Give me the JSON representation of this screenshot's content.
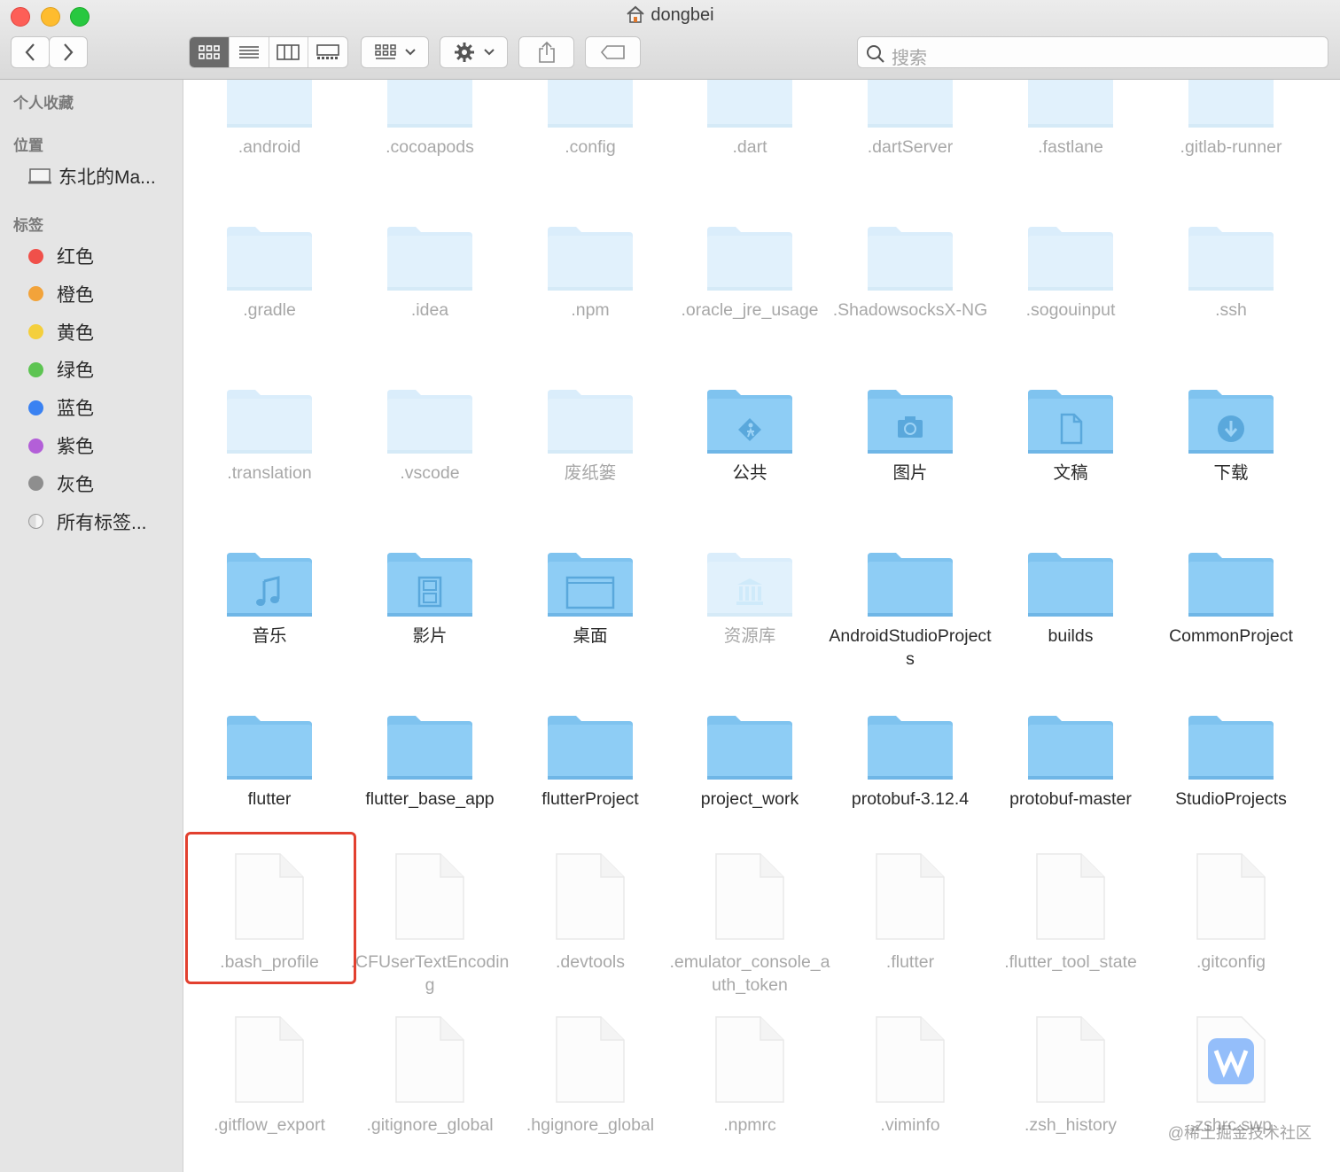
{
  "window": {
    "title": "dongbei"
  },
  "toolbar": {
    "search_placeholder": "搜索",
    "view_modes": [
      "icon-view",
      "list-view",
      "column-view",
      "gallery-view"
    ]
  },
  "sidebar": {
    "favorites_header": "个人收藏",
    "locations_header": "位置",
    "locations": [
      {
        "label": "东北的Ma..."
      }
    ],
    "tags_header": "标签",
    "tags": [
      {
        "label": "红色",
        "color": "#f0504a"
      },
      {
        "label": "橙色",
        "color": "#f2a33a"
      },
      {
        "label": "黄色",
        "color": "#f4cf3c"
      },
      {
        "label": "绿色",
        "color": "#5dc452"
      },
      {
        "label": "蓝色",
        "color": "#3a82f2"
      },
      {
        "label": "紫色",
        "color": "#b35fd8"
      },
      {
        "label": "灰色",
        "color": "#8e8e8e"
      },
      {
        "label": "所有标签...",
        "color": ""
      }
    ]
  },
  "files": [
    [
      {
        "name": ".android",
        "kind": "folder",
        "hidden": true
      },
      {
        "name": ".cocoapods",
        "kind": "folder",
        "hidden": true
      },
      {
        "name": ".config",
        "kind": "folder",
        "hidden": true
      },
      {
        "name": ".dart",
        "kind": "folder",
        "hidden": true
      },
      {
        "name": ".dartServer",
        "kind": "folder",
        "hidden": true
      },
      {
        "name": ".fastlane",
        "kind": "folder",
        "hidden": true
      },
      {
        "name": ".gitlab-runner",
        "kind": "folder",
        "hidden": true
      }
    ],
    [
      {
        "name": ".gradle",
        "kind": "folder",
        "hidden": true
      },
      {
        "name": ".idea",
        "kind": "folder",
        "hidden": true
      },
      {
        "name": ".npm",
        "kind": "folder",
        "hidden": true
      },
      {
        "name": ".oracle_jre_usage",
        "kind": "folder",
        "hidden": true
      },
      {
        "name": ".ShadowsocksX-NG",
        "kind": "folder",
        "hidden": true
      },
      {
        "name": ".sogouinput",
        "kind": "folder",
        "hidden": true
      },
      {
        "name": ".ssh",
        "kind": "folder",
        "hidden": true
      }
    ],
    [
      {
        "name": ".translation",
        "kind": "folder",
        "hidden": true
      },
      {
        "name": ".vscode",
        "kind": "folder",
        "hidden": true
      },
      {
        "name": "废纸篓",
        "kind": "folder",
        "hidden": true
      },
      {
        "name": "公共",
        "kind": "public",
        "hidden": false
      },
      {
        "name": "图片",
        "kind": "pictures",
        "hidden": false
      },
      {
        "name": "文稿",
        "kind": "documents",
        "hidden": false
      },
      {
        "name": "下载",
        "kind": "downloads",
        "hidden": false
      }
    ],
    [
      {
        "name": "音乐",
        "kind": "music",
        "hidden": false
      },
      {
        "name": "影片",
        "kind": "movies",
        "hidden": false
      },
      {
        "name": "桌面",
        "kind": "desktop",
        "hidden": false
      },
      {
        "name": "资源库",
        "kind": "library",
        "hidden": true
      },
      {
        "name": "AndroidStudioProjects",
        "kind": "folder",
        "hidden": false
      },
      {
        "name": "builds",
        "kind": "folder",
        "hidden": false
      },
      {
        "name": "CommonProject",
        "kind": "folder",
        "hidden": false
      }
    ],
    [
      {
        "name": "flutter",
        "kind": "folder",
        "hidden": false
      },
      {
        "name": "flutter_base_app",
        "kind": "folder",
        "hidden": false
      },
      {
        "name": "flutterProject",
        "kind": "folder",
        "hidden": false
      },
      {
        "name": "project_work",
        "kind": "folder",
        "hidden": false
      },
      {
        "name": "protobuf-3.12.4",
        "kind": "folder",
        "hidden": false
      },
      {
        "name": "protobuf-master",
        "kind": "folder",
        "hidden": false
      },
      {
        "name": "StudioProjects",
        "kind": "folder",
        "hidden": false
      }
    ],
    [
      {
        "name": ".bash_profile",
        "kind": "file",
        "hidden": true
      },
      {
        "name": ".CFUserTextEncoding",
        "kind": "file",
        "hidden": true
      },
      {
        "name": ".devtools",
        "kind": "file",
        "hidden": true
      },
      {
        "name": ".emulator_console_auth_token",
        "kind": "file",
        "hidden": true
      },
      {
        "name": ".flutter",
        "kind": "file",
        "hidden": true
      },
      {
        "name": ".flutter_tool_state",
        "kind": "file",
        "hidden": true
      },
      {
        "name": ".gitconfig",
        "kind": "file",
        "hidden": true
      }
    ],
    [
      {
        "name": ".gitflow_export",
        "kind": "file",
        "hidden": true
      },
      {
        "name": ".gitignore_global",
        "kind": "file",
        "hidden": true
      },
      {
        "name": ".hgignore_global",
        "kind": "file",
        "hidden": true
      },
      {
        "name": ".npmrc",
        "kind": "file",
        "hidden": true
      },
      {
        "name": ".viminfo",
        "kind": "file",
        "hidden": true
      },
      {
        "name": ".zsh_history",
        "kind": "file",
        "hidden": true
      },
      {
        "name": ".zshrc.swp",
        "kind": "wps",
        "hidden": true
      }
    ]
  ],
  "highlighted_file": ".bash_profile",
  "watermark": "@稀土掘金技术社区"
}
